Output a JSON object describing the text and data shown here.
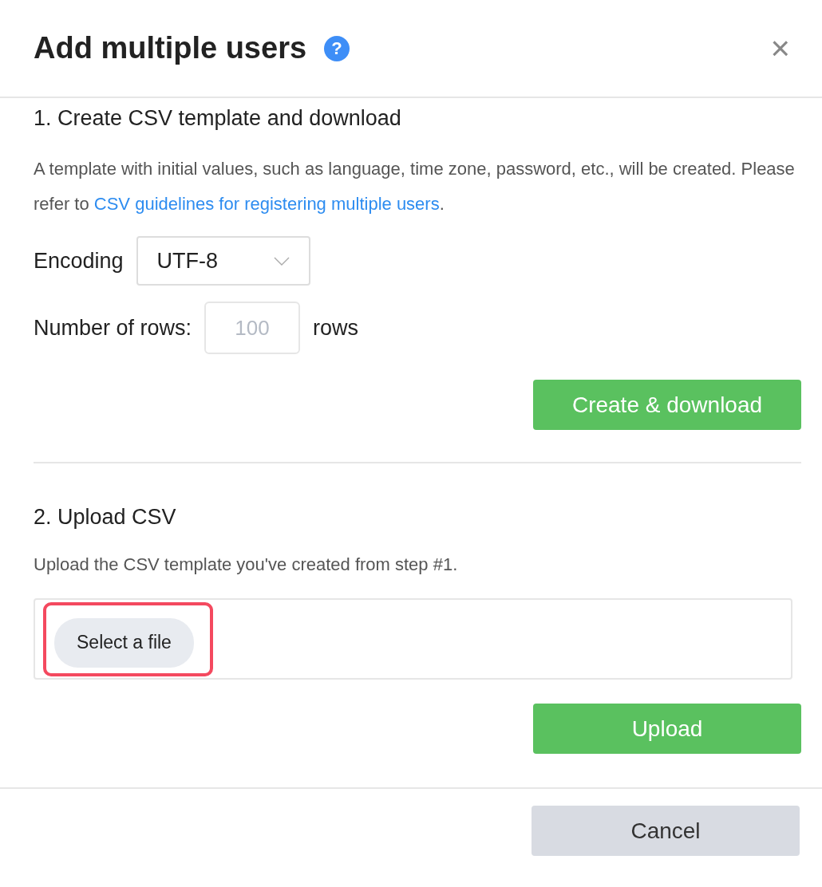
{
  "dialog": {
    "title": "Add multiple users",
    "help_icon": "?",
    "close_icon": "×"
  },
  "step1": {
    "heading": "1. Create CSV template and download",
    "description": "A template with initial values, such as language, time zone, password, etc., will be created. Please refer to ",
    "link": "CSV guidelines for registering multiple users",
    "after_link": ".",
    "encoding": {
      "label": "Encoding",
      "value": "UTF-8"
    },
    "rows": {
      "label": "Number of rows:",
      "placeholder": "100",
      "unit": "rows"
    },
    "button": "Create & download"
  },
  "step2": {
    "heading": "2. Upload CSV",
    "description": "Upload the CSV template you've created from step #1.",
    "file_button": {
      "label": "Select a file",
      "highlighted": true
    },
    "button": "Upload"
  },
  "footer": {
    "button": "Cancel"
  }
}
